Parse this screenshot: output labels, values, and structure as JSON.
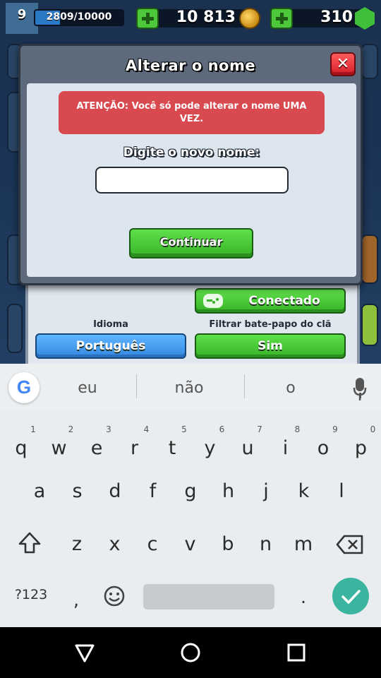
{
  "game_header": {
    "level": "9",
    "xp": "2809/10000",
    "xp_progress": 0.2809,
    "gold": "10 813",
    "gems": "310"
  },
  "dialog": {
    "title": "Alterar o nome",
    "warning": "ATENÇÃO: Você só pode alterar o nome UMA VEZ.",
    "prompt": "Digite o novo nome:",
    "name_input": {
      "value": "",
      "placeholder": ""
    },
    "close_label": "✕",
    "continue_label": "Continuar"
  },
  "settings": {
    "connected_label": "Conectado",
    "language_label": "Idioma",
    "language_value": "Português",
    "clan_chat_filter_label": "Filtrar bate-papo do clã",
    "clan_chat_filter_value": "Sim"
  },
  "keyboard": {
    "suggestions": [
      "eu",
      "não",
      "o"
    ],
    "row1": [
      "q",
      "w",
      "e",
      "r",
      "t",
      "y",
      "u",
      "i",
      "o",
      "p"
    ],
    "row1_hints": [
      "1",
      "2",
      "3",
      "4",
      "5",
      "6",
      "7",
      "8",
      "9",
      "0"
    ],
    "row2": [
      "a",
      "s",
      "d",
      "f",
      "g",
      "h",
      "j",
      "k",
      "l"
    ],
    "row3": [
      "z",
      "x",
      "c",
      "v",
      "b",
      "n",
      "m"
    ],
    "symbols_label": "?123",
    "comma": ",",
    "period": "."
  },
  "colors": {
    "accent_green": "#37b327",
    "accent_blue": "#3388e0",
    "warning_red": "#d84a4f",
    "enter_teal": "#3cb5a0"
  }
}
